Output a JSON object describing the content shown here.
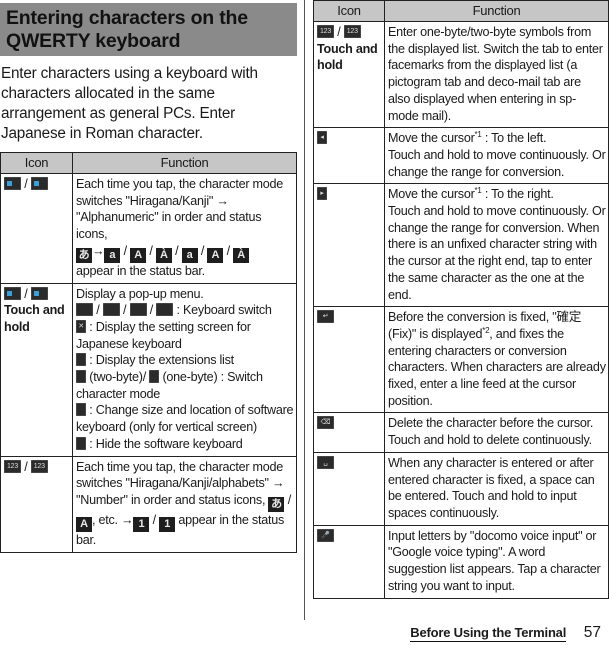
{
  "section_title": "Entering characters on the QWERTY keyboard",
  "intro": "Enter characters using a keyboard with characters allocated in the same arrangement as general PCs. Enter Japanese in Roman character.",
  "table_headers": {
    "icon": "Icon",
    "function": "Function"
  },
  "left_rows": [
    {
      "icon_label": "",
      "icons": [
        "character-mode-icon",
        "character-mode-icon-alt"
      ],
      "text_a": "Each time you tap, the character mode switches \"Hiragana/Kanji\" → \"Alphanumeric\" in order and status icons,",
      "status_icons": [
        "あ",
        "a",
        "A",
        "À",
        "a",
        "A",
        "À"
      ],
      "arrow": "→",
      "sep": "/",
      "text_b": "appear in the status bar."
    },
    {
      "icon_label": "Touch and hold",
      "lines": {
        "l1": "Display a pop-up menu.",
        "l2": ": Keyboard switch",
        "l3": ": Display the setting screen for Japanese keyboard",
        "l4": ": Display the extensions list",
        "l5a": "(two-byte)/",
        "l5b": "(one-byte) : Switch character mode",
        "l6": ": Change size and location of software keyboard (only for vertical screen)",
        "l7": ": Hide the software keyboard"
      }
    },
    {
      "icon_label": "",
      "text_a": "Each time you tap, the character mode switches \"Hiragana/Kanji/alphabets\" → \"Number\" in order and status icons,",
      "status_icons": [
        "あ",
        "A",
        "1",
        "1"
      ],
      "text_b": ", etc.",
      "text_c": "appear in the status bar."
    }
  ],
  "right_rows": [
    {
      "icon_label": "Touch and hold",
      "text": "Enter one-byte/two-byte symbols from the displayed list. Switch the tab to enter facemarks from the displayed list (a pictogram tab and deco-mail tab are also displayed when entering in sp-mode mail)."
    },
    {
      "icon": "cursor-left-icon",
      "text_a": "Move the cursor",
      "sup": "*1",
      "text_b": " : To the left.",
      "text_c": "Touch and hold to move continuously. Or change the range for conversion."
    },
    {
      "icon": "cursor-right-icon",
      "text_a": "Move the cursor",
      "sup": "*1",
      "text_b": " : To the right.",
      "text_c": "Touch and hold to move continuously. Or change the range for conversion. When there is an unfixed character string with the cursor at the right end, tap to enter the same character as the one at the end."
    },
    {
      "icon": "enter-icon",
      "text_a": "Before the conversion is fixed, \"確定 (Fix)\" is displayed",
      "sup": "*2",
      "text_b": ", and fixes the entering characters or conversion characters. When characters are already fixed, enter a line feed at the cursor position."
    },
    {
      "icon": "delete-icon",
      "text": "Delete the character before the cursor. Touch and hold to delete continuously."
    },
    {
      "icon": "space-icon",
      "text": "When any character is entered or after entered character is fixed, a space can be entered. Touch and hold to input spaces continuously."
    },
    {
      "icon": "voice-input-icon",
      "text": "Input letters by \"docomo voice input\" or \"Google voice typing\". A word suggestion list appears. Tap a character string you want to input."
    }
  ],
  "footer": {
    "section": "Before Using the Terminal",
    "page": "57"
  }
}
